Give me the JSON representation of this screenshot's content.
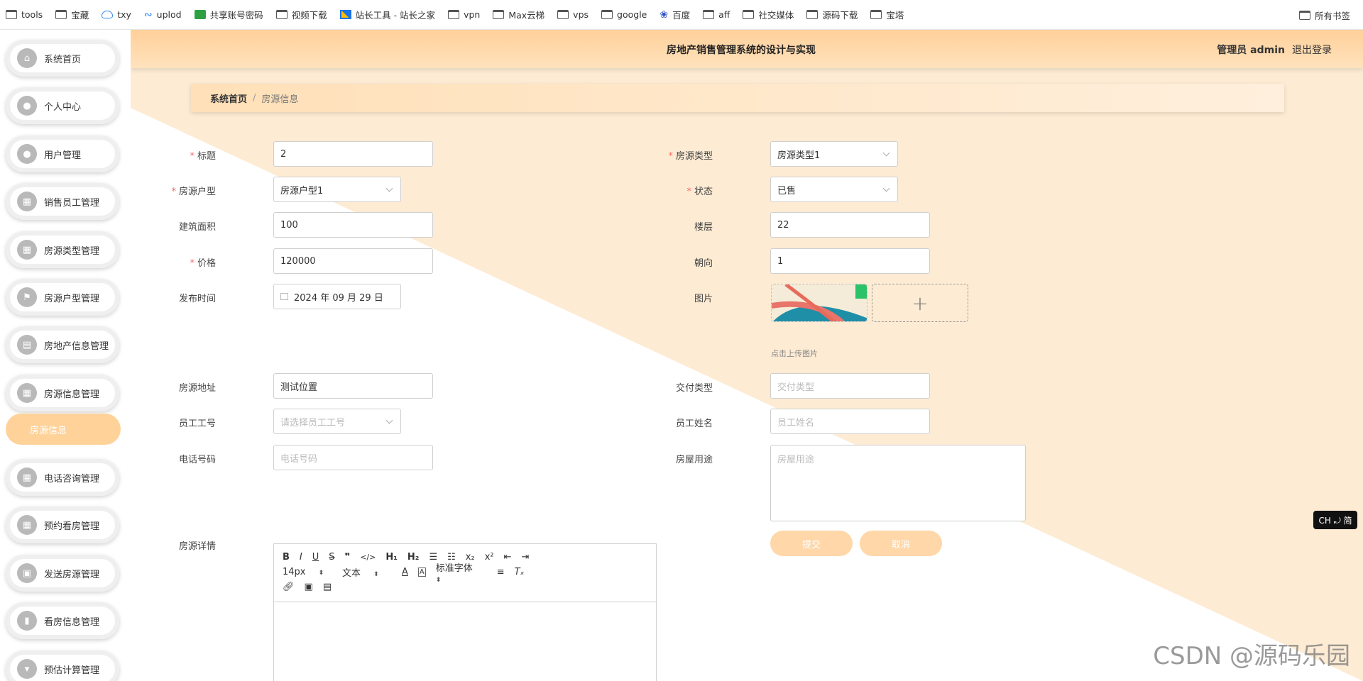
{
  "bookmarks": [
    {
      "label": "tools",
      "icon": "folder-icon"
    },
    {
      "label": "宝藏",
      "icon": "folder-icon"
    },
    {
      "label": "txy",
      "icon": "cloud-icon"
    },
    {
      "label": "uplod",
      "icon": "swirl-icon"
    },
    {
      "label": "共享账号密码",
      "icon": "grid-icon"
    },
    {
      "label": "视频下载",
      "icon": "folder-icon"
    },
    {
      "label": "站长工具 - 站长之家",
      "icon": "tool-icon"
    },
    {
      "label": "vpn",
      "icon": "folder-icon"
    },
    {
      "label": "Max云梯",
      "icon": "folder-icon"
    },
    {
      "label": "vps",
      "icon": "folder-icon"
    },
    {
      "label": "google",
      "icon": "folder-icon"
    },
    {
      "label": "百度",
      "icon": "paw-icon"
    },
    {
      "label": "aff",
      "icon": "folder-icon"
    },
    {
      "label": "社交媒体",
      "icon": "folder-icon"
    },
    {
      "label": "源码下载",
      "icon": "folder-icon"
    },
    {
      "label": "宝塔",
      "icon": "folder-icon"
    }
  ],
  "bookmarks_right": "所有书签",
  "header": {
    "title": "房地产销售管理系统的设计与实现",
    "user": "管理员 admin",
    "logout": "退出登录"
  },
  "breadcrumb": {
    "home": "系统首页",
    "sep": "/",
    "current": "房源信息"
  },
  "sidebar": {
    "items": [
      {
        "label": "系统首页",
        "icon": "home-icon",
        "glyph": "⌂"
      },
      {
        "label": "个人中心",
        "icon": "user-icon",
        "glyph": "●"
      },
      {
        "label": "用户管理",
        "icon": "user-icon",
        "glyph": "●"
      },
      {
        "label": "销售员工管理",
        "icon": "grid-icon",
        "glyph": "▦"
      },
      {
        "label": "房源类型管理",
        "icon": "grid-icon",
        "glyph": "▦"
      },
      {
        "label": "房源户型管理",
        "icon": "flag-icon",
        "glyph": "⚑"
      },
      {
        "label": "房地产信息管理",
        "icon": "briefcase-icon",
        "glyph": "▤"
      },
      {
        "label": "房源信息管理",
        "icon": "grid-icon",
        "glyph": "▦"
      },
      {
        "label": "电话咨询管理",
        "icon": "grid-icon",
        "glyph": "▦"
      },
      {
        "label": "预约看房管理",
        "icon": "grid-icon",
        "glyph": "▦"
      },
      {
        "label": "发送房源管理",
        "icon": "clipboard-icon",
        "glyph": "▣"
      },
      {
        "label": "看房信息管理",
        "icon": "bar-chart-icon",
        "glyph": "▮"
      },
      {
        "label": "预估计算管理",
        "icon": "funnel-icon",
        "glyph": "▾"
      }
    ],
    "active_sub": "房源信息"
  },
  "form": {
    "title_label": "标题",
    "title_value": "2",
    "type_label": "房源类型",
    "type_value": "房源类型1",
    "layout_label": "房源户型",
    "layout_value": "房源户型1",
    "status_label": "状态",
    "status_value": "已售",
    "area_label": "建筑面积",
    "area_value": "100",
    "floor_label": "楼层",
    "floor_value": "22",
    "price_label": "价格",
    "price_value": "120000",
    "orientation_label": "朝向",
    "orientation_value": "1",
    "publish_label": "发布时间",
    "publish_value": "2024 年 09 月 29 日",
    "image_label": "图片",
    "upload_hint": "点击上传图片",
    "upload_plus": "+",
    "address_label": "房源地址",
    "address_value": "测试位置",
    "delivery_label": "交付类型",
    "delivery_placeholder": "交付类型",
    "staff_id_label": "员工工号",
    "staff_id_placeholder": "请选择员工工号",
    "staff_name_label": "员工姓名",
    "staff_name_placeholder": "员工姓名",
    "phone_label": "电话号码",
    "phone_placeholder": "电话号码",
    "usage_label": "房屋用途",
    "usage_placeholder": "房屋用途",
    "detail_label": "房源详情",
    "submit": "提交",
    "cancel": "取消"
  },
  "editor": {
    "font_size": "14px",
    "text_style": "文本",
    "font_family": "标准字体"
  },
  "ime": "CH ⤾ 简",
  "watermark": "CSDN @源码乐园",
  "colors": {
    "accent": "#ffd09a",
    "button": "#ffd7a8",
    "bg_diag": "#fdebd3"
  }
}
